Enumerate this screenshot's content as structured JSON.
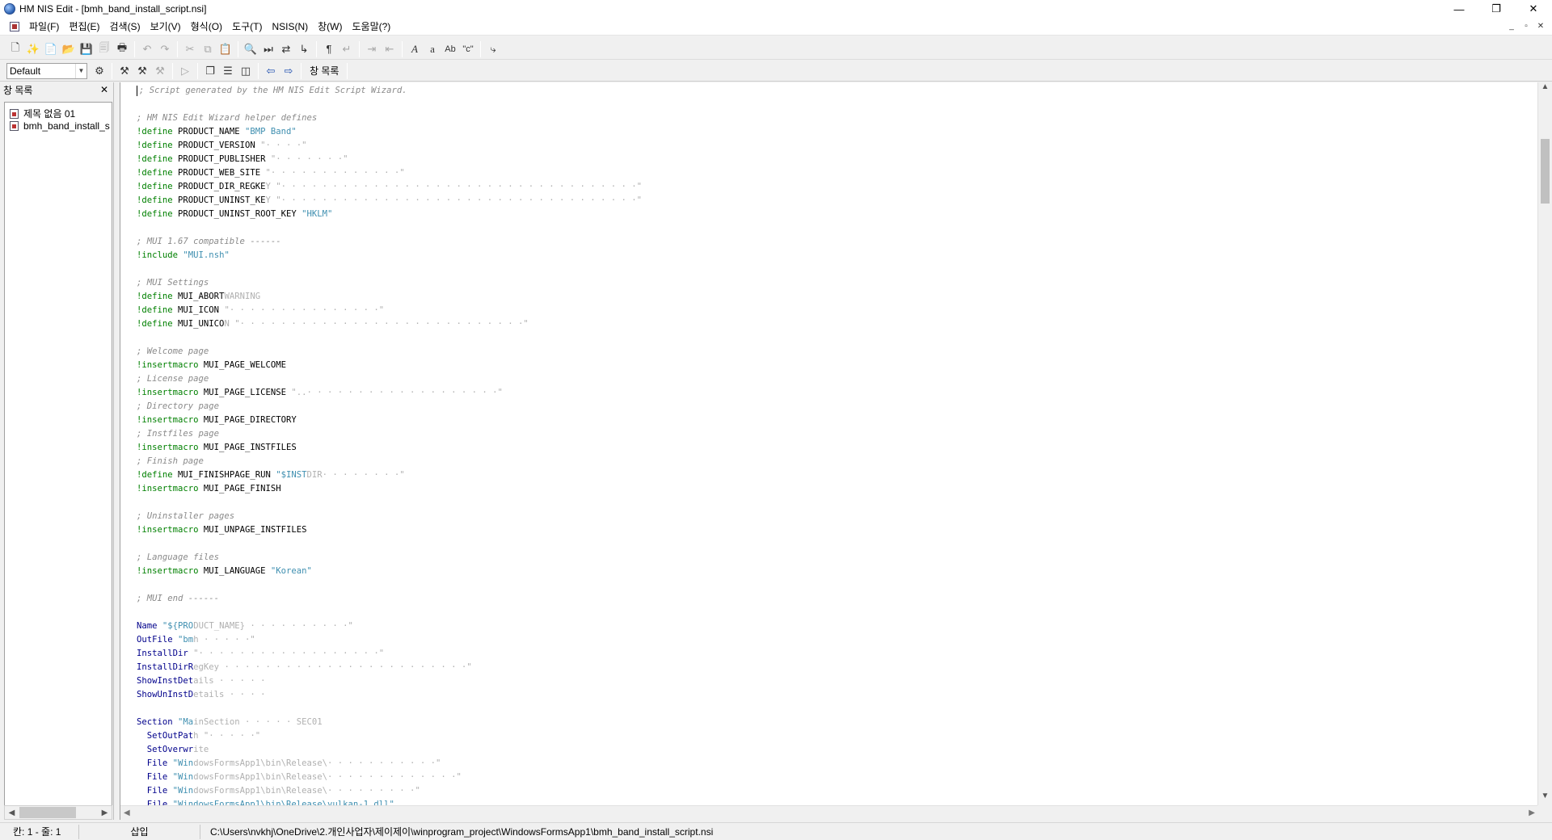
{
  "window": {
    "title": "HM NIS Edit - [bmh_band_install_script.nsi]",
    "minimize": "—",
    "restore": "❐",
    "close": "✕"
  },
  "menu": {
    "items": [
      "파일(F)",
      "편집(E)",
      "검색(S)",
      "보기(V)",
      "형식(O)",
      "도구(T)",
      "NSIS(N)",
      "창(W)",
      "도움말(?)"
    ],
    "mdi_min": "_",
    "mdi_restore": "▫",
    "mdi_close": "✕"
  },
  "toolbar2": {
    "combo_value": "Default",
    "window_list_label": "창 목록"
  },
  "left_panel": {
    "title": "창 목록",
    "close": "✕",
    "items": [
      "제목 없음 01",
      "bmh_band_install_s"
    ]
  },
  "editor": {
    "lines": [
      {
        "cls": "c-comment",
        "text": "; Script generated by the HM NIS Edit Script Wizard."
      },
      {
        "cls": "c-plain",
        "text": ""
      },
      {
        "cls": "c-comment",
        "text": "; HM NIS Edit Wizard helper defines"
      },
      {
        "cls": "mix",
        "parts": [
          [
            "c-directive",
            "!define"
          ],
          [
            "c-plain",
            " PRODUCT_NAME "
          ],
          [
            "c-string",
            "\"BMP Band\""
          ]
        ]
      },
      {
        "cls": "mix",
        "parts": [
          [
            "c-directive",
            "!define"
          ],
          [
            "c-plain",
            " PRODUCT_VERSION "
          ],
          [
            "c-redacted",
            "\"· · · ·\""
          ]
        ]
      },
      {
        "cls": "mix",
        "parts": [
          [
            "c-directive",
            "!define"
          ],
          [
            "c-plain",
            " PRODUCT_PUBLISHER "
          ],
          [
            "c-redacted",
            "\"· · · · · · ·\""
          ]
        ]
      },
      {
        "cls": "mix",
        "parts": [
          [
            "c-directive",
            "!define"
          ],
          [
            "c-plain",
            " PRODUCT_WEB_SITE "
          ],
          [
            "c-redacted",
            "\"· · · · · · · · · · · · ·\""
          ]
        ]
      },
      {
        "cls": "mix",
        "parts": [
          [
            "c-directive",
            "!define"
          ],
          [
            "c-plain",
            " PRODUCT_DIR_REGKE"
          ],
          [
            "c-redacted",
            "Y \"· · · · · · · · · · · · · · · · · · · · · · · · · · · · · · · · · · ·\""
          ]
        ]
      },
      {
        "cls": "mix",
        "parts": [
          [
            "c-directive",
            "!define"
          ],
          [
            "c-plain",
            " PRODUCT_UNINST_KE"
          ],
          [
            "c-redacted",
            "Y \"· · · · · · · · · · · · · · · · · · · · · · · · · · · · · · · · · · ·\""
          ]
        ]
      },
      {
        "cls": "mix",
        "parts": [
          [
            "c-directive",
            "!define"
          ],
          [
            "c-plain",
            " PRODUCT_UNINST_ROOT_KEY "
          ],
          [
            "c-string",
            "\"HKLM\""
          ]
        ]
      },
      {
        "cls": "c-plain",
        "text": ""
      },
      {
        "cls": "c-comment",
        "text": "; MUI 1.67 compatible ------"
      },
      {
        "cls": "mix",
        "parts": [
          [
            "c-directive",
            "!include"
          ],
          [
            "c-plain",
            " "
          ],
          [
            "c-string",
            "\"MUI.nsh\""
          ]
        ]
      },
      {
        "cls": "c-plain",
        "text": ""
      },
      {
        "cls": "c-comment",
        "text": "; MUI Settings"
      },
      {
        "cls": "mix",
        "parts": [
          [
            "c-directive",
            "!define"
          ],
          [
            "c-plain",
            " MUI_ABORT"
          ],
          [
            "c-redacted",
            "WARNING"
          ]
        ]
      },
      {
        "cls": "mix",
        "parts": [
          [
            "c-directive",
            "!define"
          ],
          [
            "c-plain",
            " MUI_ICON "
          ],
          [
            "c-redacted",
            "\"· · · · · · · · · · · · · · ·\""
          ]
        ]
      },
      {
        "cls": "mix",
        "parts": [
          [
            "c-directive",
            "!define"
          ],
          [
            "c-plain",
            " MUI_UNICO"
          ],
          [
            "c-redacted",
            "N \"· · · · · · · · · · · · · · · · · · · · · · · · · · · ·\""
          ]
        ]
      },
      {
        "cls": "c-plain",
        "text": ""
      },
      {
        "cls": "c-comment",
        "text": "; Welcome page"
      },
      {
        "cls": "mix",
        "parts": [
          [
            "c-directive",
            "!insertmacro"
          ],
          [
            "c-plain",
            " MUI_PAGE_WELCOME"
          ]
        ]
      },
      {
        "cls": "c-comment",
        "text": "; License page"
      },
      {
        "cls": "mix",
        "parts": [
          [
            "c-directive",
            "!insertmacro"
          ],
          [
            "c-plain",
            " MUI_PAGE_LICENSE "
          ],
          [
            "c-redacted",
            "\"..· · · · · · · · · · · · · · · · · · ·\""
          ]
        ]
      },
      {
        "cls": "c-comment",
        "text": "; Directory page"
      },
      {
        "cls": "mix",
        "parts": [
          [
            "c-directive",
            "!insertmacro"
          ],
          [
            "c-plain",
            " MUI_PAGE_DIRECTORY"
          ]
        ]
      },
      {
        "cls": "c-comment",
        "text": "; Instfiles page"
      },
      {
        "cls": "mix",
        "parts": [
          [
            "c-directive",
            "!insertmacro"
          ],
          [
            "c-plain",
            " MUI_PAGE_INSTFILES"
          ]
        ]
      },
      {
        "cls": "c-comment",
        "text": "; Finish page"
      },
      {
        "cls": "mix",
        "parts": [
          [
            "c-directive",
            "!define"
          ],
          [
            "c-plain",
            " MUI_FINISHPAGE_RUN "
          ],
          [
            "c-string",
            "\"$INST"
          ],
          [
            "c-redacted",
            "DIR· · · · · · · ·\""
          ]
        ]
      },
      {
        "cls": "mix",
        "parts": [
          [
            "c-directive",
            "!insertmacro"
          ],
          [
            "c-plain",
            " MUI_PAGE_FINISH"
          ]
        ]
      },
      {
        "cls": "c-plain",
        "text": ""
      },
      {
        "cls": "c-comment",
        "text": "; Uninstaller pages"
      },
      {
        "cls": "mix",
        "parts": [
          [
            "c-directive",
            "!insertmacro"
          ],
          [
            "c-plain",
            " MUI_UNPAGE_INSTFILES"
          ]
        ]
      },
      {
        "cls": "c-plain",
        "text": ""
      },
      {
        "cls": "c-comment",
        "text": "; Language files"
      },
      {
        "cls": "mix",
        "parts": [
          [
            "c-directive",
            "!insertmacro"
          ],
          [
            "c-plain",
            " MUI_LANGUAGE "
          ],
          [
            "c-string",
            "\"Korean\""
          ]
        ]
      },
      {
        "cls": "c-plain",
        "text": ""
      },
      {
        "cls": "c-comment",
        "text": "; MUI end ------"
      },
      {
        "cls": "c-plain",
        "text": ""
      },
      {
        "cls": "mix",
        "parts": [
          [
            "c-keyword",
            "Name"
          ],
          [
            "c-plain",
            " "
          ],
          [
            "c-string",
            "\"${PRO"
          ],
          [
            "c-redacted",
            "DUCT_NAME} · · · · · · · · · ·\""
          ]
        ]
      },
      {
        "cls": "mix",
        "parts": [
          [
            "c-keyword",
            "OutFile"
          ],
          [
            "c-plain",
            " "
          ],
          [
            "c-string",
            "\"bm"
          ],
          [
            "c-redacted",
            "h · · · · ·\""
          ]
        ]
      },
      {
        "cls": "mix",
        "parts": [
          [
            "c-keyword",
            "InstallDir"
          ],
          [
            "c-plain",
            " "
          ],
          [
            "c-redacted",
            "\"· · · · · · · · · · · · · · · · · ·\""
          ]
        ]
      },
      {
        "cls": "mix",
        "parts": [
          [
            "c-keyword",
            "InstallDirR"
          ],
          [
            "c-redacted",
            "egKey · · · · · · · · · · · · · · · · · · · · · · · ·\""
          ]
        ]
      },
      {
        "cls": "mix",
        "parts": [
          [
            "c-keyword",
            "ShowInstDet"
          ],
          [
            "c-redacted",
            "ails · · · · ·"
          ]
        ]
      },
      {
        "cls": "mix",
        "parts": [
          [
            "c-keyword",
            "ShowUnInstD"
          ],
          [
            "c-redacted",
            "etails · · · ·"
          ]
        ]
      },
      {
        "cls": "c-plain",
        "text": ""
      },
      {
        "cls": "mix",
        "parts": [
          [
            "c-keyword",
            "Section"
          ],
          [
            "c-plain",
            " "
          ],
          [
            "c-string",
            "\"Ma"
          ],
          [
            "c-redacted",
            "inSection · · · · · SEC01"
          ]
        ]
      },
      {
        "cls": "mix",
        "parts": [
          [
            "c-plain",
            "  "
          ],
          [
            "c-keyword",
            "SetOutPat"
          ],
          [
            "c-redacted",
            "h \"· · · · ·\""
          ]
        ]
      },
      {
        "cls": "mix",
        "parts": [
          [
            "c-plain",
            "  "
          ],
          [
            "c-keyword",
            "SetOverwr"
          ],
          [
            "c-redacted",
            "ite"
          ]
        ]
      },
      {
        "cls": "mix",
        "parts": [
          [
            "c-plain",
            "  "
          ],
          [
            "c-keyword",
            "File"
          ],
          [
            "c-plain",
            " "
          ],
          [
            "c-string",
            "\"Win"
          ],
          [
            "c-redacted",
            "dowsFormsApp1\\bin\\Release\\· · · · · · · · · · ·\""
          ]
        ]
      },
      {
        "cls": "mix",
        "parts": [
          [
            "c-plain",
            "  "
          ],
          [
            "c-keyword",
            "File"
          ],
          [
            "c-plain",
            " "
          ],
          [
            "c-string",
            "\"Win"
          ],
          [
            "c-redacted",
            "dowsFormsApp1\\bin\\Release\\· · · · · · · · · · · · ·\""
          ]
        ]
      },
      {
        "cls": "mix",
        "parts": [
          [
            "c-plain",
            "  "
          ],
          [
            "c-keyword",
            "File"
          ],
          [
            "c-plain",
            " "
          ],
          [
            "c-string",
            "\"Win"
          ],
          [
            "c-redacted",
            "dowsFormsApp1\\bin\\Release\\· · · · · · · · ·\""
          ]
        ]
      },
      {
        "cls": "mix",
        "parts": [
          [
            "c-plain",
            "  "
          ],
          [
            "c-keyword",
            "File"
          ],
          [
            "c-plain",
            " "
          ],
          [
            "c-string",
            "\"WindowsFormsApp1\\bin\\Release\\vulkan-1.dll\""
          ]
        ]
      }
    ]
  },
  "statusbar": {
    "position": "칸: 1 - 줄: 1",
    "mode": "삽입",
    "path": "C:\\Users\\nvkhj\\OneDrive\\2.개인사업자\\제이제이\\winprogram_project\\WindowsFormsApp1\\bmh_band_install_script.nsi"
  }
}
